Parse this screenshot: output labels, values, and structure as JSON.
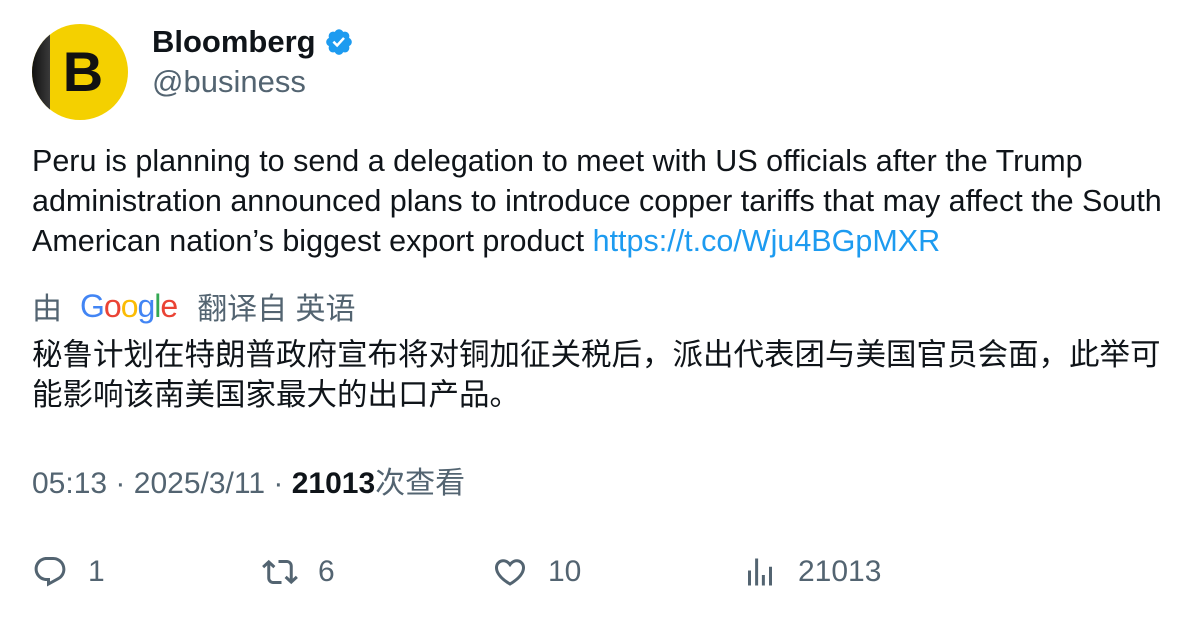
{
  "tweet": {
    "author": {
      "display_name": "Bloomberg",
      "handle": "@business",
      "avatar_letter": "B",
      "verified": true
    },
    "text": "Peru is planning to send a delegation to meet with US officials after the Trump administration announced plans to introduce copper tariffs that may affect the South American nation’s biggest export product ",
    "link": "https://t.co/Wju4BGpMXR",
    "translation": {
      "by_label": "由",
      "provider": "Google",
      "from_label": "翻译自 英语",
      "text": "秘鲁计划在特朗普政府宣布将对铜加征关税后，派出代表团与美国官员会面，此举可能影响该南美国家最大的出口产品。"
    },
    "meta": {
      "time": "05:13",
      "date": "2025/3/11",
      "separator": "·",
      "views_count": "21013",
      "views_label": "次查看"
    },
    "actions": {
      "replies": "1",
      "reposts": "6",
      "likes": "10",
      "views": "21013"
    }
  },
  "colors": {
    "text_primary": "#0f1419",
    "text_secondary": "#536471",
    "link": "#1d9bf0",
    "verified": "#1d9bf0",
    "avatar_bg": "#f4d000"
  },
  "icons": {
    "verified": "verified-badge-icon",
    "reply": "reply-icon",
    "repost": "repost-icon",
    "like": "heart-icon",
    "views": "analytics-icon"
  }
}
